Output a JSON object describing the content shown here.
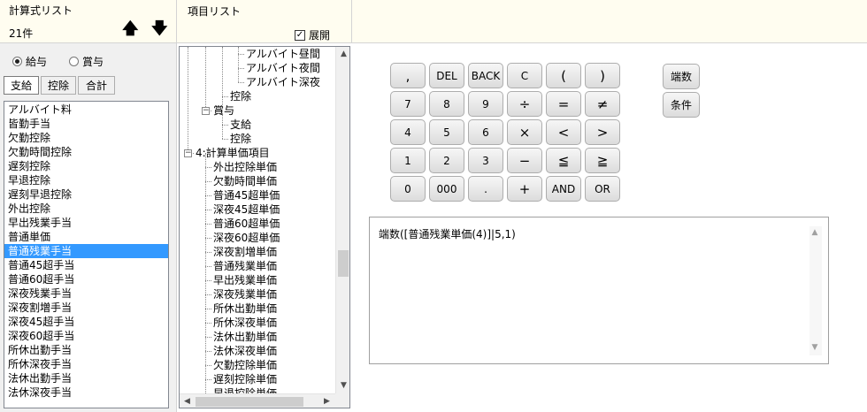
{
  "calc_panel": {
    "title": "計算式リスト",
    "count": "21件",
    "up_icon": "arrow-up-icon",
    "down_icon": "arrow-down-icon",
    "radio_pay": "給与",
    "radio_bonus": "賞与",
    "tabs": [
      "支給",
      "控除",
      "合計"
    ],
    "items": [
      "アルバイト料",
      "皆勤手当",
      "欠勤控除",
      "欠勤時間控除",
      "遅刻控除",
      "早退控除",
      "遅刻早退控除",
      "外出控除",
      "早出残業手当",
      "普通単価",
      "普通残業手当",
      "普通45超手当",
      "普通60超手当",
      "深夜残業手当",
      "深夜割増手当",
      "深夜45超手当",
      "深夜60超手当",
      "所休出勤手当",
      "所休深夜手当",
      "法休出勤手当",
      "法休深夜手当"
    ],
    "selected_index": 10
  },
  "item_panel": {
    "title": "項目リスト",
    "expand_label": "展開",
    "expand_checked": true,
    "tree": [
      {
        "label": "アルバイト昼間"
      },
      {
        "label": "アルバイト夜間"
      },
      {
        "label": "アルバイト深夜"
      },
      {
        "label": "控除"
      },
      {
        "label": "賞与"
      },
      {
        "label": "支給"
      },
      {
        "label": "控除"
      },
      {
        "label": "4:計算単価項目"
      },
      {
        "label": "外出控除単価"
      },
      {
        "label": "欠勤時間単価"
      },
      {
        "label": "普通45超単価"
      },
      {
        "label": "深夜45超単価"
      },
      {
        "label": "普通60超単価"
      },
      {
        "label": "深夜60超単価"
      },
      {
        "label": "深夜割増単価"
      },
      {
        "label": "普通残業単価"
      },
      {
        "label": "早出残業単価"
      },
      {
        "label": "深夜残業単価"
      },
      {
        "label": "所休出勤単価"
      },
      {
        "label": "所休深夜単価"
      },
      {
        "label": "法休出勤単価"
      },
      {
        "label": "法休深夜単価"
      },
      {
        "label": "欠勤控除単価"
      },
      {
        "label": "遅刻控除単価"
      },
      {
        "label": "早退控除単価"
      }
    ]
  },
  "keypad": {
    "rows": [
      [
        ",",
        "DEL",
        "BACK",
        "C",
        "(",
        ")"
      ],
      [
        "7",
        "8",
        "9",
        "÷",
        "=",
        "≠"
      ],
      [
        "4",
        "5",
        "6",
        "×",
        "<",
        ">"
      ],
      [
        "1",
        "2",
        "3",
        "−",
        "≦",
        "≧"
      ],
      [
        "0",
        "000",
        ".",
        "+",
        "AND",
        "OR"
      ]
    ],
    "func_round": "端数",
    "func_cond": "条件"
  },
  "formula": {
    "text": "端数([普通残業単価(4)]|5,1)"
  }
}
